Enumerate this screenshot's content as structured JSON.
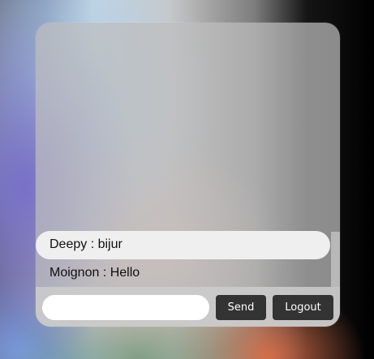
{
  "chat": {
    "messages": [
      {
        "sender": "Deepy",
        "text": "bijur",
        "display": "Deepy : bijur"
      },
      {
        "sender": "Moignon",
        "text": "Hello",
        "display": "Moignon : Hello"
      }
    ]
  },
  "composer": {
    "input_value": "",
    "input_placeholder": "",
    "send_label": "Send",
    "logout_label": "Logout"
  },
  "colors": {
    "button_bg": "#333333",
    "highlighted_message_bg": "#efefef"
  }
}
